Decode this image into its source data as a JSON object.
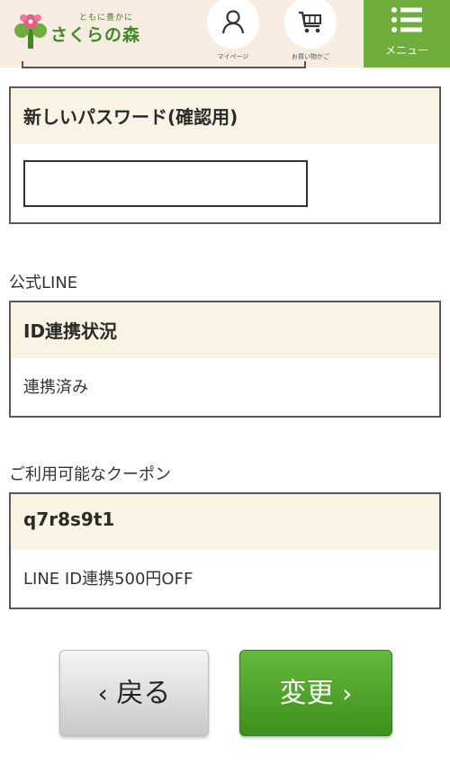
{
  "header": {
    "logo_tagline": "ともに豊かに",
    "logo_name": "さくらの森",
    "mypage_label": "マイページ",
    "cart_label": "お買い物かご",
    "menu_label": "メニュー",
    "brand_color": "#6fae3c"
  },
  "password_confirm": {
    "label": "新しいパスワード(確認用)",
    "value": ""
  },
  "line_section": {
    "section_label": "公式LINE",
    "header": "ID連携状況",
    "status": "連携済み"
  },
  "coupon_section": {
    "section_label": "ご利用可能なクーポン",
    "code": "q7r8s9t1",
    "description": "LINE ID連携500円OFF"
  },
  "buttons": {
    "back_label": "戻る",
    "back_chevron": "‹",
    "change_label": "変更",
    "change_chevron": "›"
  },
  "icons": [
    "sakura-logo-icon",
    "user-icon",
    "cart-icon",
    "hamburger-menu-icon"
  ]
}
